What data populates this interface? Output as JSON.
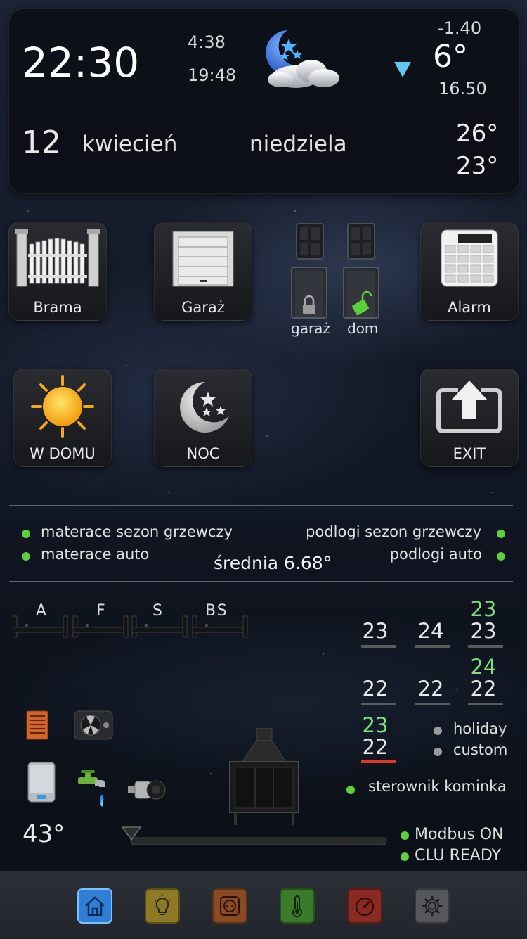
{
  "header": {
    "time": "22:30",
    "sunrise": "4:38",
    "sunset": "19:48",
    "weather_icon": "moon-cloud-icon",
    "trend_icon": "down-arrow-icon",
    "temp_outside": "6°",
    "temp_min": "-1.40",
    "temp_max": "16.50",
    "day": "12",
    "month": "kwiecień",
    "weekday": "niedziela",
    "temp_a": "26°",
    "temp_b": "23°"
  },
  "tiles": {
    "brama": "Brama",
    "garaz": "Garaż",
    "alarm": "Alarm",
    "w_domu": "W DOMU",
    "noc": "NOC",
    "exit": "EXIT"
  },
  "locks": {
    "garaz": "garaż",
    "dom": "dom"
  },
  "status": {
    "materace_sezon": "materace sezon grzewczy",
    "materace_auto": "materace auto",
    "podlogi_sezon": "podlogi sezon grzewczy",
    "podlogi_auto": "podlogi auto",
    "srednia": "średnia 6.68°"
  },
  "shades": [
    "A",
    "F",
    "S",
    "BS"
  ],
  "grid": {
    "r1c1": "23",
    "r1c2": "24",
    "r1c3_top": "23",
    "r1c3": "23",
    "r2c1": "22",
    "r2c2": "22",
    "r2c3_top": "24",
    "r2c3": "22",
    "r3c1_top": "23",
    "r3c1": "22"
  },
  "modes": {
    "holiday": "holiday",
    "custom": "custom"
  },
  "fireplace": {
    "label": "sterownik kominka"
  },
  "boiler": {
    "temp": "43°"
  },
  "system": {
    "modbus": "Modbus ON",
    "clu": "CLU READY"
  },
  "nav": [
    {
      "icon": "home-icon",
      "color": "#2f7fd6"
    },
    {
      "icon": "bulb-icon",
      "color": "#8d7a24"
    },
    {
      "icon": "socket-icon",
      "color": "#8a4a24"
    },
    {
      "icon": "thermometer-icon",
      "color": "#3b7a2a"
    },
    {
      "icon": "gauge-icon",
      "color": "#8a2a22"
    },
    {
      "icon": "gear-icon",
      "color": "#55575c"
    }
  ],
  "colors": {
    "status_green": "#5ccf3a",
    "accent_blue": "#62c7f0",
    "alarm_red": "#e0342c"
  }
}
